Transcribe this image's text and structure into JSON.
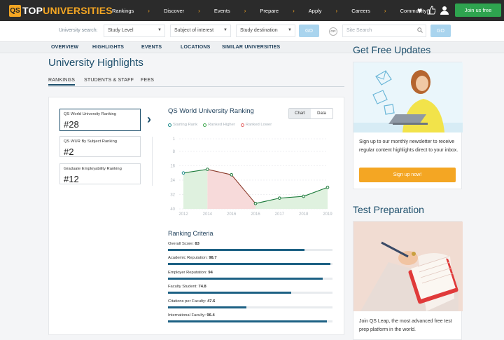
{
  "header": {
    "logo_top": "TOP",
    "logo_uni": "UNIVERSITIES",
    "logo_mark": "QS",
    "nav": [
      "Rankings",
      "Discover",
      "Events",
      "Prepare",
      "Apply",
      "Careers",
      "Community"
    ],
    "join_label": "Join us free",
    "icons": [
      "heart-icon",
      "thumbs-up-icon",
      "user-icon"
    ]
  },
  "search": {
    "label": "University search:",
    "study_level": "Study Level",
    "subject": "Subject of interest",
    "destination": "Study destination",
    "go": "GO",
    "or": "OR",
    "site_placeholder": "Site Search",
    "go2": "GO"
  },
  "subnav": [
    "OVERVIEW",
    "HIGHLIGHTS",
    "EVENTS",
    "LOCATIONS",
    "SIMILAR UNIVERSITIES"
  ],
  "page": {
    "title": "University Highlights",
    "tabs": [
      "RANKINGS",
      "STUDENTS & STAFF",
      "FEES"
    ]
  },
  "rankings": [
    {
      "label": "QS World University Ranking",
      "value": "#28"
    },
    {
      "label": "QS WUR By Subject Ranking",
      "value": "#2"
    },
    {
      "label": "Graduate Employability Ranking",
      "value": "#12"
    }
  ],
  "chart_panel": {
    "title": "QS World University Ranking",
    "toggle_chart": "Chart",
    "toggle_data": "Data",
    "legend": [
      "Starting Rank",
      "Ranked Higher",
      "Ranked Lower"
    ],
    "colors": {
      "line": "#1b7a3a",
      "higher": "#dff1df",
      "lower": "#f7dada",
      "start": "#1b8a8a",
      "grid": "#e4e6e9"
    }
  },
  "chart_data": {
    "type": "line",
    "x": [
      2012,
      2014,
      2016,
      2017,
      2018,
      2019
    ],
    "x_ticks": [
      "2012",
      "2014",
      "2016",
      "2016",
      "2017",
      "2018",
      "2019"
    ],
    "series": [
      {
        "values": [
          20,
          18,
          21,
          37,
          34,
          33,
          28
        ]
      }
    ],
    "y_ticks": [
      "1",
      "8",
      "16",
      "24",
      "32",
      "40"
    ],
    "ylim": [
      1,
      40
    ],
    "y_inverted": true,
    "grid": true
  },
  "criteria": {
    "title": "Ranking Criteria",
    "items": [
      {
        "label": "Overall Score:",
        "value": "83",
        "score": 83
      },
      {
        "label": "Academic Reputation:",
        "value": "98.7",
        "score": 98.7
      },
      {
        "label": "Employer Reputation:",
        "value": "94",
        "score": 94
      },
      {
        "label": "Faculty Student:",
        "value": "74.8",
        "score": 74.8
      },
      {
        "label": "Citations per Faculty:",
        "value": "47.6",
        "score": 47.6
      },
      {
        "label": "International Faculty:",
        "value": "96.4",
        "score": 96.4
      }
    ]
  },
  "sidebar": {
    "updates_heading": "Get Free Updates",
    "newsletter_text": "Sign up to our monthly newsletter to receive regular content highlights direct to your inbox.",
    "signup_label": "Sign up now!",
    "test_heading": "Test Preparation",
    "test_text": "Join QS Leap, the most advanced free test prep platform in the world."
  }
}
